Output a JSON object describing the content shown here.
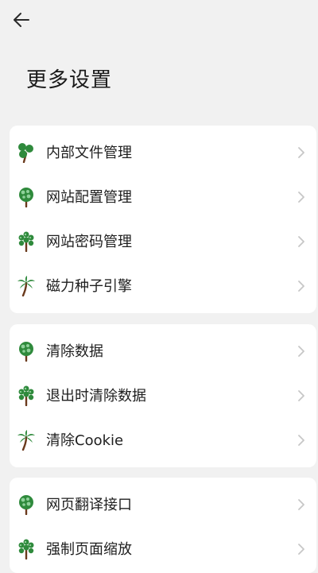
{
  "header": {
    "title": "更多设置"
  },
  "groups": [
    {
      "items": [
        {
          "label": "内部文件管理",
          "icon": "tree-clover-icon"
        },
        {
          "label": "网站配置管理",
          "icon": "tree-round-light-icon"
        },
        {
          "label": "网站密码管理",
          "icon": "tree-bubbles-icon"
        },
        {
          "label": "磁力种子引擎",
          "icon": "palm-tree-icon"
        }
      ]
    },
    {
      "items": [
        {
          "label": "清除数据",
          "icon": "tree-round-light-icon"
        },
        {
          "label": "退出时清除数据",
          "icon": "tree-bubbles-icon"
        },
        {
          "label": "清除Cookie",
          "icon": "palm-tree-icon"
        }
      ]
    },
    {
      "items": [
        {
          "label": "网页翻译接口",
          "icon": "tree-round-light-icon"
        },
        {
          "label": "强制页面缩放",
          "icon": "tree-bubbles-icon"
        }
      ]
    }
  ],
  "colors": {
    "background": "#f1f1f1",
    "card": "#ffffff",
    "leaf_dark": "#2f8a3c",
    "leaf_light": "#8fd19a",
    "trunk": "#6b3a1d",
    "chevron": "#c7c7c7"
  }
}
